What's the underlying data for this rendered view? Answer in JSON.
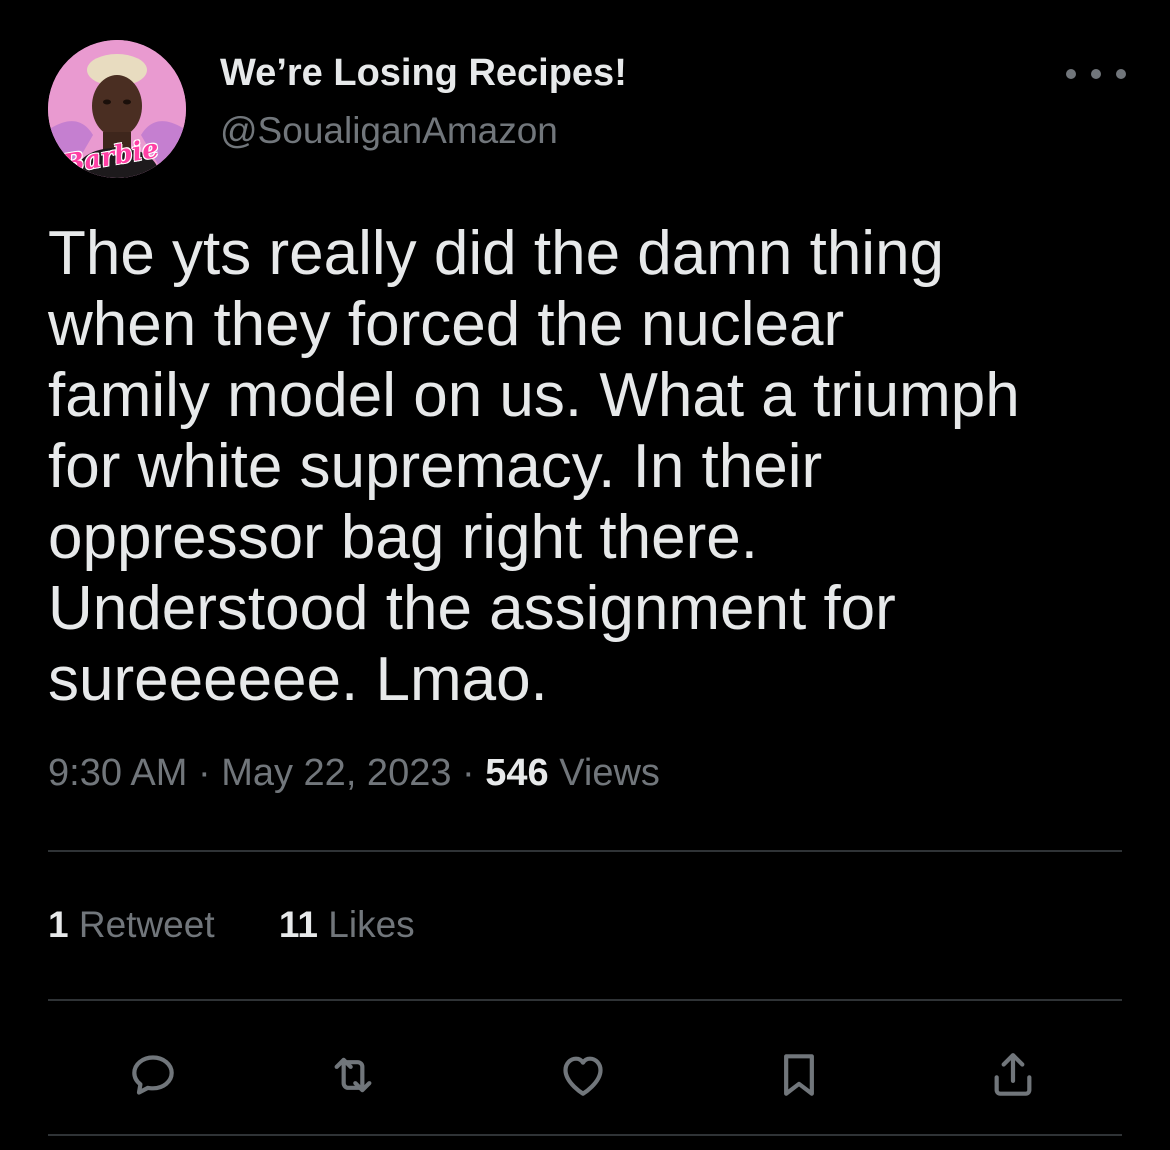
{
  "author": {
    "display_name": "We’re Losing Recipes!",
    "handle": "@SoualiganAmazon",
    "avatar_label": "Barbie",
    "avatar_icon": "profile-photo"
  },
  "tweet": {
    "text": "The yts really did the damn thing\nwhen they forced the nuclear\nfamily model on us. What a triumph\nfor white supremacy. In their\noppressor bag right there.\nUnderstood the assignment for\nsureeeeee. Lmao.",
    "time": "9:30 AM",
    "separator": "·",
    "date": "May 22, 2023",
    "views_count": "546",
    "views_label": "Views"
  },
  "stats": {
    "retweets_count": "1",
    "retweets_label": "Retweet",
    "likes_count": "11",
    "likes_label": "Likes"
  },
  "actions": [
    {
      "icon": "reply-icon"
    },
    {
      "icon": "retweet-icon"
    },
    {
      "icon": "like-icon"
    },
    {
      "icon": "bookmark-icon"
    },
    {
      "icon": "share-icon"
    }
  ],
  "colors": {
    "background": "#000000",
    "primary_text": "#e7e9ea",
    "secondary_text": "#71767b",
    "divider": "#2f3336"
  }
}
